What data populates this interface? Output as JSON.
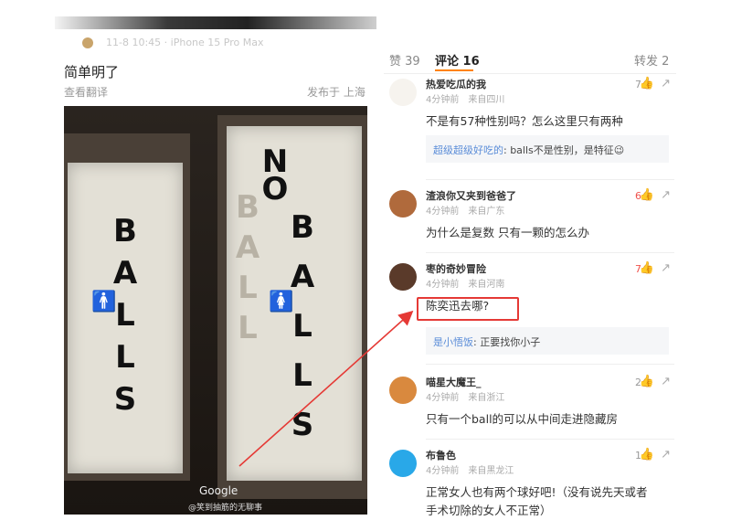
{
  "post": {
    "meta_text": "11-8 10:45 · iPhone 15 Pro Max",
    "title": "简单明了",
    "translate": "查看翻译",
    "posted_at": "发布于 上海",
    "photo": {
      "left_door_word": [
        "B",
        "A",
        "L",
        "L",
        "S"
      ],
      "right_door_top": [
        "N",
        "O"
      ],
      "right_door_word": [
        "B",
        "A",
        "L",
        "L",
        "S"
      ],
      "right_door_ghost": [
        "B",
        "A",
        "L",
        "L"
      ],
      "watermark_google": "Google",
      "watermark_weibo": "@笑到抽筋的无聊事"
    }
  },
  "tabs": {
    "likes": "赞 39",
    "comments": "评论 16",
    "reposts": "转发 2"
  },
  "comments": [
    {
      "user": "热爱吃瓜的我",
      "time": "4分钟前　来自四川",
      "text": "不是有57种性别吗？怎么这里只有两种",
      "likes": "7",
      "hot": false,
      "avatar_color": "#f6f3ee",
      "reply_user": "超级超级好吃的",
      "reply_text": ": balls不是性别，是特征😉"
    },
    {
      "user": "渣浪你又夹到爸爸了",
      "time": "4分钟前　来自广东",
      "text": "为什么是复数 只有一颗的怎么办",
      "likes": "6",
      "hot": true,
      "avatar_color": "#b06a3c"
    },
    {
      "user": "枣的奇妙冒险",
      "time": "4分钟前　来自河南",
      "text": "陈奕迅去哪?",
      "likes": "7",
      "hot": true,
      "avatar_color": "#5a3a2a",
      "reply_user": "是小悟饭",
      "reply_text": ": 正要找你小子"
    },
    {
      "user": "喵星大魔王_",
      "time": "4分钟前　来自浙江",
      "text": "只有一个ball的可以从中间走进隐藏房",
      "likes": "2",
      "hot": false,
      "avatar_color": "#d9893e"
    },
    {
      "user": "布鲁色",
      "time": "4分钟前　来自黑龙江",
      "text": "正常女人也有两个球好吧!（没有说先天或者",
      "text2": "手术切除的女人不正常）",
      "likes": "1",
      "hot": false,
      "avatar_color": "#29a8e8"
    }
  ],
  "colors": {
    "accent": "#ff8200",
    "like_hot": "#f0524c",
    "reply_user": "#5b8dd8",
    "highlight": "#e53935"
  }
}
